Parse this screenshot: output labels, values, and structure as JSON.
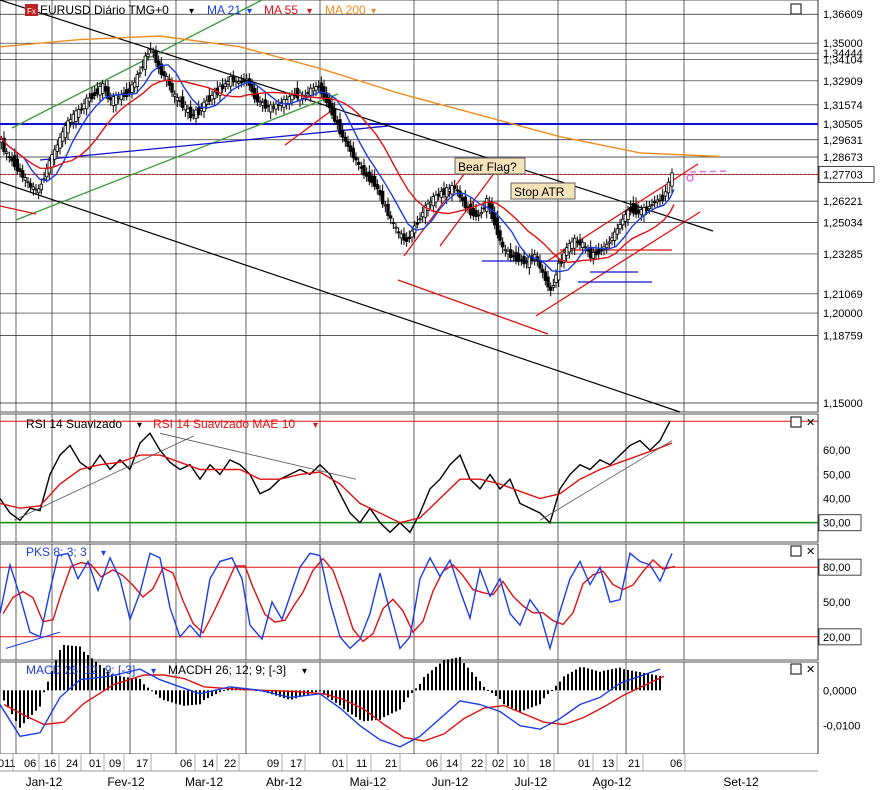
{
  "chart_data": [
    {
      "type": "line",
      "panel": "price",
      "legend": [
        {
          "text": "EURUSD Diário TMG+0",
          "color": "#000000"
        },
        {
          "text": "MA 21",
          "color": "#1a3ee6"
        },
        {
          "text": "MA 55",
          "color": "#e01010"
        },
        {
          "text": "MA 200",
          "color": "#f08c1e"
        }
      ],
      "ylim": [
        1.145,
        1.374
      ],
      "y_ticks": [
        "1,36609",
        "1,35000",
        "1,34444",
        "1,34104",
        "1,32909",
        "1,31574",
        "1,30505",
        "1,29631",
        "1,28673",
        "1,27703",
        "1,26221",
        "1,25034",
        "1,23285",
        "1,21069",
        "1,20000",
        "1,18759",
        "1,15000"
      ],
      "y_tick_values": [
        1.36609,
        1.35,
        1.34444,
        1.34104,
        1.32909,
        1.31574,
        1.30505,
        1.29631,
        1.28673,
        1.27703,
        1.26221,
        1.25034,
        1.23285,
        1.21069,
        1.2,
        1.18759,
        1.15
      ],
      "highlighted_price": "1,27703",
      "annotations": [
        "Bear Flag?",
        "Stop ATR"
      ],
      "close_path": [
        [
          0,
          1.298
        ],
        [
          8,
          1.288
        ],
        [
          16,
          1.283
        ],
        [
          24,
          1.276
        ],
        [
          32,
          1.27
        ],
        [
          40,
          1.268
        ],
        [
          48,
          1.28
        ],
        [
          56,
          1.29
        ],
        [
          64,
          1.3
        ],
        [
          72,
          1.308
        ],
        [
          80,
          1.312
        ],
        [
          88,
          1.318
        ],
        [
          96,
          1.322
        ],
        [
          104,
          1.326
        ],
        [
          112,
          1.318
        ],
        [
          120,
          1.32
        ],
        [
          128,
          1.322
        ],
        [
          136,
          1.328
        ],
        [
          144,
          1.338
        ],
        [
          152,
          1.348
        ],
        [
          160,
          1.336
        ],
        [
          168,
          1.33
        ],
        [
          176,
          1.32
        ],
        [
          184,
          1.316
        ],
        [
          192,
          1.31
        ],
        [
          200,
          1.312
        ],
        [
          208,
          1.318
        ],
        [
          216,
          1.322
        ],
        [
          224,
          1.326
        ],
        [
          232,
          1.33
        ],
        [
          240,
          1.328
        ],
        [
          248,
          1.33
        ],
        [
          256,
          1.32
        ],
        [
          264,
          1.316
        ],
        [
          272,
          1.314
        ],
        [
          280,
          1.316
        ],
        [
          288,
          1.318
        ],
        [
          296,
          1.322
        ],
        [
          304,
          1.32
        ],
        [
          312,
          1.324
        ],
        [
          320,
          1.326
        ],
        [
          328,
          1.318
        ],
        [
          336,
          1.308
        ],
        [
          344,
          1.298
        ],
        [
          352,
          1.29
        ],
        [
          360,
          1.282
        ],
        [
          368,
          1.276
        ],
        [
          376,
          1.272
        ],
        [
          384,
          1.262
        ],
        [
          392,
          1.252
        ],
        [
          400,
          1.244
        ],
        [
          408,
          1.24
        ],
        [
          416,
          1.248
        ],
        [
          424,
          1.256
        ],
        [
          432,
          1.262
        ],
        [
          440,
          1.266
        ],
        [
          448,
          1.268
        ],
        [
          456,
          1.27
        ],
        [
          464,
          1.262
        ],
        [
          472,
          1.256
        ],
        [
          480,
          1.254
        ],
        [
          488,
          1.262
        ],
        [
          496,
          1.25
        ],
        [
          504,
          1.236
        ],
        [
          512,
          1.232
        ],
        [
          520,
          1.23
        ],
        [
          528,
          1.228
        ],
        [
          536,
          1.232
        ],
        [
          544,
          1.222
        ],
        [
          552,
          1.212
        ],
        [
          560,
          1.226
        ],
        [
          568,
          1.236
        ],
        [
          576,
          1.24
        ],
        [
          584,
          1.238
        ],
        [
          592,
          1.232
        ],
        [
          600,
          1.234
        ],
        [
          608,
          1.238
        ],
        [
          616,
          1.244
        ],
        [
          624,
          1.252
        ],
        [
          632,
          1.258
        ],
        [
          640,
          1.256
        ],
        [
          648,
          1.258
        ],
        [
          656,
          1.262
        ],
        [
          664,
          1.264
        ],
        [
          670,
          1.272
        ],
        [
          674,
          1.277
        ]
      ]
    },
    {
      "type": "line",
      "panel": "rsi",
      "legend": [
        {
          "text": "RSI 14 Suavizado",
          "color": "#000000"
        },
        {
          "text": "RSI 14 Suavizado MAE 10",
          "color": "#e01010"
        }
      ],
      "ylim": [
        22,
        75
      ],
      "y_ticks": [
        "60,00",
        "50,00",
        "40,00",
        "30,00"
      ],
      "y_tick_values": [
        60,
        50,
        40,
        30
      ],
      "highlighted_level": "30,00",
      "series": [
        {
          "name": "RSI 14 Suavizado",
          "color": "#000000",
          "points": [
            [
              0,
              40
            ],
            [
              10,
              34
            ],
            [
              20,
              31
            ],
            [
              30,
              36
            ],
            [
              40,
              35
            ],
            [
              50,
              50
            ],
            [
              60,
              58
            ],
            [
              70,
              62
            ],
            [
              80,
              55
            ],
            [
              90,
              52
            ],
            [
              100,
              58
            ],
            [
              110,
              52
            ],
            [
              120,
              56
            ],
            [
              130,
              52
            ],
            [
              140,
              63
            ],
            [
              150,
              67
            ],
            [
              160,
              60
            ],
            [
              170,
              55
            ],
            [
              180,
              52
            ],
            [
              190,
              54
            ],
            [
              200,
              48
            ],
            [
              210,
              54
            ],
            [
              220,
              50
            ],
            [
              230,
              56
            ],
            [
              240,
              54
            ],
            [
              250,
              50
            ],
            [
              260,
              42
            ],
            [
              270,
              44
            ],
            [
              280,
              48
            ],
            [
              290,
              50
            ],
            [
              300,
              52
            ],
            [
              310,
              50
            ],
            [
              320,
              54
            ],
            [
              330,
              50
            ],
            [
              340,
              42
            ],
            [
              350,
              34
            ],
            [
              360,
              30
            ],
            [
              370,
              36
            ],
            [
              380,
              30
            ],
            [
              390,
              26
            ],
            [
              400,
              30
            ],
            [
              410,
              26
            ],
            [
              420,
              34
            ],
            [
              430,
              44
            ],
            [
              440,
              48
            ],
            [
              450,
              54
            ],
            [
              460,
              58
            ],
            [
              470,
              48
            ],
            [
              480,
              44
            ],
            [
              490,
              50
            ],
            [
              500,
              44
            ],
            [
              510,
              48
            ],
            [
              520,
              38
            ],
            [
              530,
              36
            ],
            [
              540,
              34
            ],
            [
              550,
              30
            ],
            [
              560,
              44
            ],
            [
              570,
              50
            ],
            [
              580,
              54
            ],
            [
              590,
              52
            ],
            [
              600,
              56
            ],
            [
              610,
              54
            ],
            [
              620,
              58
            ],
            [
              630,
              62
            ],
            [
              640,
              64
            ],
            [
              650,
              60
            ],
            [
              660,
              64
            ],
            [
              670,
              72
            ]
          ]
        },
        {
          "name": "RSI 14 Suavizado MAE 10",
          "color": "#e01010",
          "points": [
            [
              0,
              38
            ],
            [
              20,
              36
            ],
            [
              40,
              37
            ],
            [
              60,
              46
            ],
            [
              80,
              52
            ],
            [
              100,
              54
            ],
            [
              120,
              55
            ],
            [
              140,
              58
            ],
            [
              160,
              58
            ],
            [
              180,
              55
            ],
            [
              200,
              52
            ],
            [
              220,
              52
            ],
            [
              240,
              52
            ],
            [
              260,
              48
            ],
            [
              280,
              48
            ],
            [
              300,
              50
            ],
            [
              320,
              51
            ],
            [
              340,
              46
            ],
            [
              360,
              38
            ],
            [
              380,
              34
            ],
            [
              400,
              30
            ],
            [
              420,
              32
            ],
            [
              440,
              40
            ],
            [
              460,
              48
            ],
            [
              480,
              48
            ],
            [
              500,
              46
            ],
            [
              520,
              43
            ],
            [
              540,
              40
            ],
            [
              560,
              42
            ],
            [
              580,
              48
            ],
            [
              600,
              52
            ],
            [
              620,
              55
            ],
            [
              640,
              58
            ],
            [
              660,
              61
            ],
            [
              672,
              63
            ]
          ]
        }
      ]
    },
    {
      "type": "line",
      "panel": "stochastic",
      "legend": [
        {
          "text": "PKS 8; 3; 3",
          "color": "#1a3ee6"
        }
      ],
      "ylim": [
        0,
        100
      ],
      "y_ticks": [
        "80,00",
        "50,00",
        "20,00"
      ],
      "y_tick_values": [
        80,
        50,
        20
      ],
      "highlighted_levels": [
        "80,00",
        "20,00"
      ]
    },
    {
      "type": "line",
      "panel": "macd",
      "legend": [
        {
          "text": "MACD 26; 12; 9; [-3]",
          "color": "#1a3ee6"
        },
        {
          "text": "MACDH 26; 12; 9; [-3]",
          "color": "#000000"
        }
      ],
      "ylim": [
        -0.018,
        0.008
      ],
      "y_ticks": [
        "0,0000",
        "-0,0100"
      ],
      "y_tick_values": [
        0,
        -0.01
      ]
    }
  ],
  "x_axis": {
    "day_labels": [
      "011",
      "06",
      "16",
      "24",
      "01",
      "09",
      "17",
      "06",
      "14",
      "22",
      "09",
      "17",
      "01",
      "11",
      "21",
      "06",
      "14",
      "22",
      "02",
      "10",
      "18",
      "01",
      "13",
      "21",
      "06"
    ],
    "month_labels": [
      "Jan-12",
      "Fev-12",
      "Mar-12",
      "Abr-12",
      "Mai-12",
      "Jun-12",
      "Jul-12",
      "Ago-12",
      "Set-12"
    ]
  },
  "colors": {
    "price_up": "#000000",
    "ma21": "#1a3ee6",
    "ma55": "#e01010",
    "ma200": "#f08c1e",
    "channel_green": "#3a9a3a",
    "level_blue": "#1010d0",
    "rsi_30_line": "#138a13",
    "panel_border": "#8a8a8a",
    "label_box": "#f4e2b8"
  }
}
